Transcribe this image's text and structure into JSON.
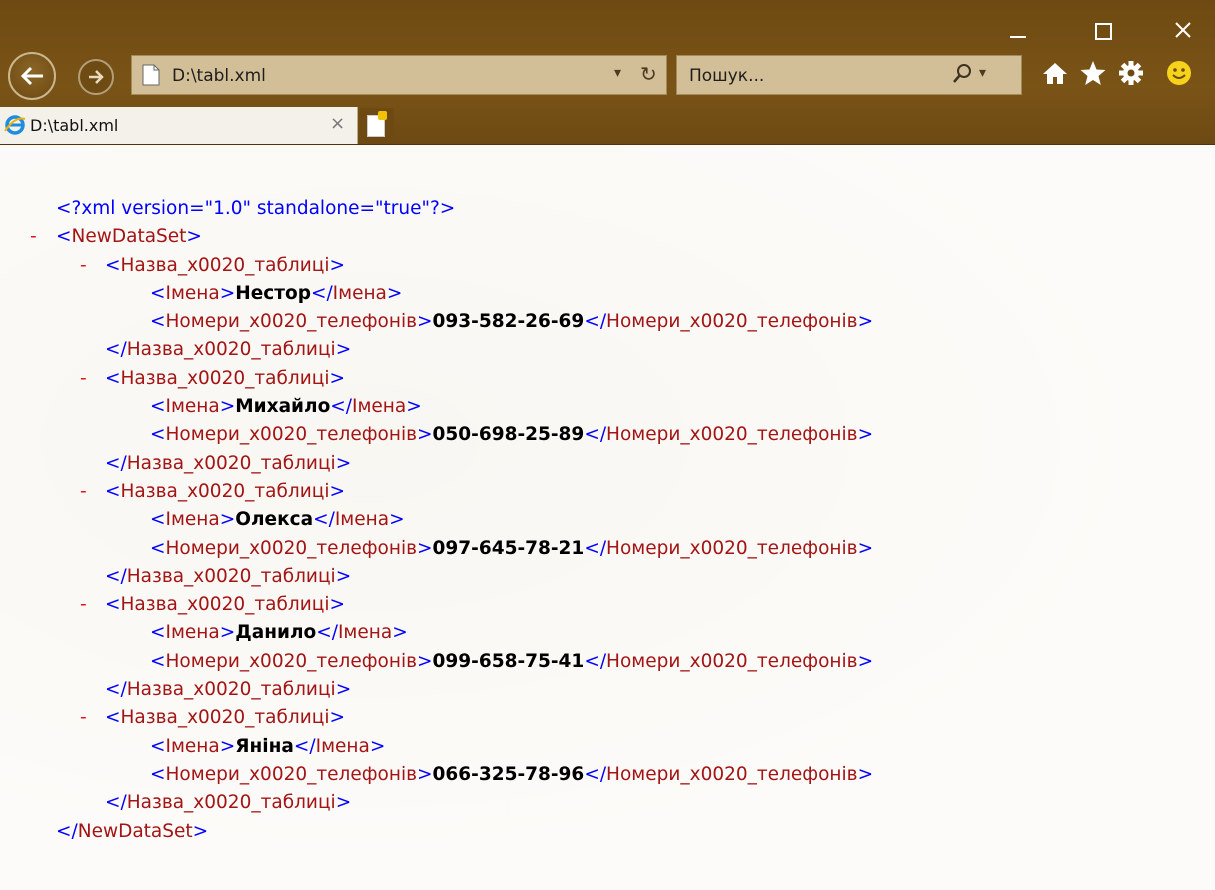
{
  "window": {
    "address_url": "D:\\tabl.xml",
    "search_placeholder": "Пошук...",
    "tab_title": "D:\\tabl.xml"
  },
  "icons": {
    "back": "back-arrow-icon",
    "forward": "forward-arrow-icon",
    "refresh": "refresh-icon",
    "search": "search-icon",
    "home": "home-icon",
    "favorites": "star-icon",
    "tools": "gear-icon",
    "feedback": "smiley-icon"
  },
  "colors": {
    "chrome": "#6e4a12",
    "markup_blue": "#0000ff",
    "tag_red": "#a31515",
    "collapse_red": "#e3111a"
  },
  "xml": {
    "declaration": "<?xml version=\"1.0\" standalone=\"true\"?>",
    "root_tag": "NewDataSet",
    "row_tag": "Назва_x0020_таблиці",
    "name_tag": "Імена",
    "phone_tag": "Номери_x0020_телефонів",
    "collapse_glyph": "-",
    "records": [
      {
        "name": "Нестор",
        "phone": "093-582-26-69"
      },
      {
        "name": "Михайло",
        "phone": "050-698-25-89"
      },
      {
        "name": "Олекса",
        "phone": "097-645-78-21"
      },
      {
        "name": "Данило",
        "phone": "099-658-75-41"
      },
      {
        "name": "Яніна",
        "phone": "066-325-78-96"
      }
    ]
  }
}
